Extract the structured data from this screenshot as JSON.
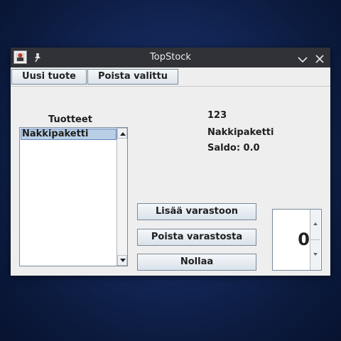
{
  "window": {
    "title": "TopStock"
  },
  "toolbar": {
    "new_product_label": "Uusi tuote",
    "delete_selected_label": "Poista valittu"
  },
  "product_list": {
    "heading": "Tuotteet",
    "items": [
      {
        "label": "Nakkipaketti",
        "selected": true
      }
    ]
  },
  "details": {
    "code": "123",
    "name": "Nakkipaketti",
    "balance": "Saldo: 0.0"
  },
  "actions": {
    "add_label": "Lisää varastoon",
    "remove_label": "Poista varastosta",
    "reset_label": "Nollaa"
  },
  "quantity": {
    "value": "0"
  },
  "icons": [
    "app-icon",
    "pin-icon",
    "chevron-down-icon",
    "close-icon",
    "scroll-up-icon",
    "scroll-down-icon",
    "spin-up-icon",
    "spin-down-icon"
  ],
  "colors": {
    "titlebar": "#303238",
    "selection": "#b8cfe5",
    "window_bg": "#eeeeee"
  }
}
